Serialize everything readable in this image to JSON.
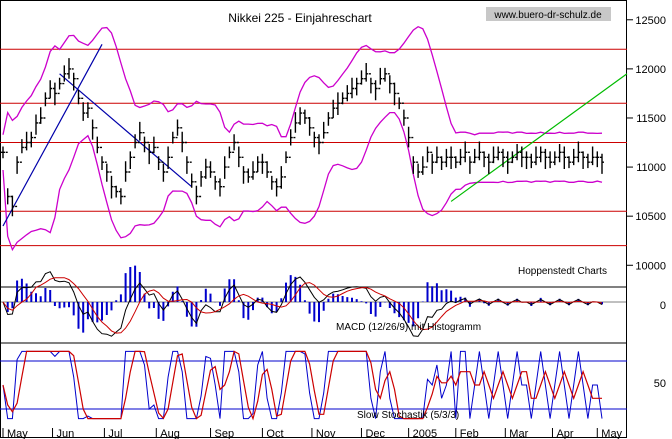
{
  "chart_data": {
    "type": "line",
    "title": "Nikkei 225 - Einjahreschart",
    "watermark": "www.buero-dr-schulz.de",
    "source_note": "Hoppenstedt Charts",
    "price_axis": {
      "ticks": [
        10000,
        10500,
        11000,
        11500,
        12000,
        12500
      ],
      "ylim": [
        9850,
        12620
      ]
    },
    "months": [
      "May",
      "Jun",
      "Jul",
      "Aug",
      "Sep",
      "Oct",
      "Nov",
      "Dec",
      "2005",
      "Feb",
      "Mar",
      "Apr",
      "May"
    ],
    "resistance_levels": [
      12200,
      11650,
      11250,
      10550,
      10200
    ],
    "price_series": {
      "name": "Nikkei 225",
      "x_days": [
        0,
        2,
        4,
        6,
        8,
        10,
        12,
        14,
        16,
        18,
        20,
        22,
        24,
        26,
        28,
        30,
        32,
        34,
        36,
        38,
        40,
        42,
        44,
        46,
        48,
        50,
        52,
        54,
        56,
        58,
        60,
        62,
        64,
        66,
        68,
        70,
        72,
        74,
        76,
        78,
        80,
        82,
        84,
        86,
        88,
        90,
        92,
        94,
        96,
        98,
        100,
        102,
        104,
        106,
        108,
        110,
        112,
        114,
        116,
        118,
        120,
        122,
        124,
        126,
        128,
        130,
        132,
        134,
        136,
        138,
        140,
        142,
        144,
        146,
        148,
        150,
        152,
        154,
        156,
        158,
        160,
        162,
        164,
        166,
        168,
        170,
        172,
        174,
        176,
        178,
        180,
        182,
        184,
        186,
        188,
        190,
        192,
        194,
        196,
        198,
        200,
        202,
        204,
        206,
        208,
        210,
        212,
        214,
        216,
        218,
        220,
        222,
        224,
        226,
        228,
        230,
        232,
        234,
        236,
        238,
        240,
        242,
        244,
        246,
        248,
        250,
        252,
        254
      ],
      "close": [
        11150,
        10700,
        10600,
        11050,
        11200,
        11250,
        11300,
        11450,
        11500,
        11700,
        11800,
        11750,
        11850,
        11950,
        12000,
        11900,
        11700,
        11550,
        11600,
        11400,
        11200,
        11050,
        10950,
        10800,
        10750,
        10700,
        10950,
        11100,
        11250,
        11350,
        11250,
        11150,
        11200,
        11050,
        10950,
        11100,
        11300,
        11400,
        11250,
        11050,
        10850,
        10700,
        10900,
        11000,
        10950,
        10850,
        10800,
        11000,
        11150,
        11250,
        11100,
        10950,
        10900,
        10950,
        11050,
        11050,
        10950,
        10850,
        10800,
        10900,
        11100,
        11300,
        11450,
        11550,
        11500,
        11400,
        11300,
        11250,
        11350,
        11500,
        11600,
        11650,
        11700,
        11750,
        11800,
        11850,
        11900,
        11950,
        11850,
        11800,
        11900,
        11950,
        11850,
        11750,
        11650,
        11500,
        11300,
        11050,
        10950,
        11000,
        11150,
        11050,
        11100,
        11050,
        11100,
        11100,
        11050,
        11100,
        11150,
        11050,
        11100,
        11150,
        11100,
        11050,
        11100,
        11150,
        11100,
        11050,
        11100,
        11150,
        11100,
        11100,
        11050,
        11100,
        11150,
        11100,
        11050,
        11100,
        11150,
        11100,
        11050,
        11100,
        11150,
        11100,
        11050,
        11100,
        11100,
        11050
      ]
    },
    "trend_lines": [
      {
        "name": "uptrend-channel",
        "points": [
          [
            0,
            10400
          ],
          [
            42,
            12250
          ]
        ]
      },
      {
        "name": "downtrend",
        "points": [
          [
            24,
            11950
          ],
          [
            80,
            10800
          ]
        ]
      },
      {
        "name": "uptrend-2005",
        "points": [
          [
            190,
            10650
          ],
          [
            270,
            11950
          ]
        ]
      }
    ],
    "macd": {
      "label": "MACD (12/26/9) mit Histogramm",
      "tick": 0
    },
    "stochastic": {
      "label": "Slow Stochastik (5/3/3)",
      "tick": 50,
      "overbought": 80,
      "oversold": 20
    }
  }
}
